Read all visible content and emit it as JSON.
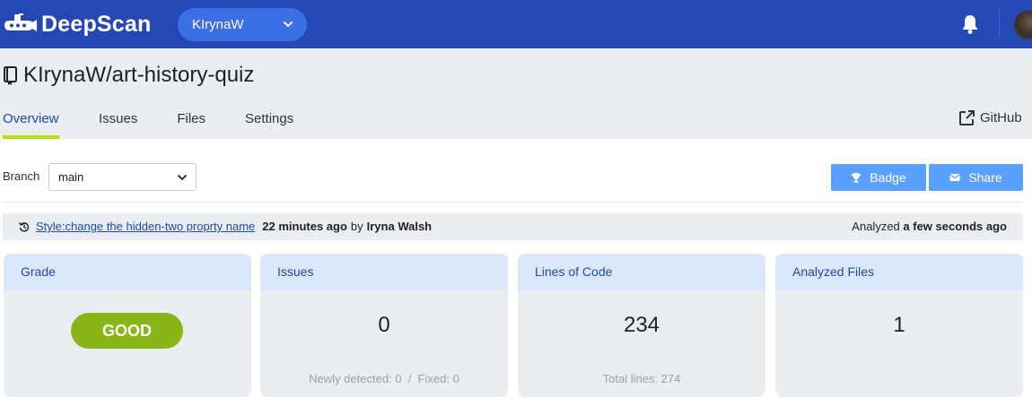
{
  "topbar": {
    "brand": "DeepScan",
    "account": "KIrynaW",
    "colors": {
      "bar": "#2548b4",
      "account_pill": "#3c6fe6"
    }
  },
  "repo": {
    "title": "KIrynaW/art-history-quiz",
    "tabs": [
      {
        "label": "Overview",
        "active": true
      },
      {
        "label": "Issues",
        "active": false
      },
      {
        "label": "Files",
        "active": false
      },
      {
        "label": "Settings",
        "active": false
      }
    ],
    "github_label": "GitHub"
  },
  "toolbar": {
    "branch_label": "Branch",
    "branch_value": "main",
    "badge_label": "Badge",
    "share_label": "Share"
  },
  "commit": {
    "message": "Style:change the hidden-two proprty name",
    "time": "22 minutes ago",
    "by": "by",
    "author": "Iryna Walsh",
    "analyzed_prefix": "Analyzed",
    "analyzed_time": "a few seconds ago"
  },
  "cards": {
    "grade": {
      "title": "Grade",
      "value": "GOOD",
      "color": "#8ab517"
    },
    "issues": {
      "title": "Issues",
      "value": "0",
      "footer": "Newly detected: 0  /  Fixed: 0"
    },
    "loc": {
      "title": "Lines of Code",
      "value": "234",
      "footer": "Total lines: 274"
    },
    "files": {
      "title": "Analyzed Files",
      "value": "1"
    }
  },
  "icons": [
    "submarine-logo-icon",
    "chevron-down-icon",
    "bell-icon",
    "avatar",
    "repo-book-icon",
    "external-link-icon",
    "trophy-icon",
    "envelope-icon",
    "history-icon"
  ]
}
